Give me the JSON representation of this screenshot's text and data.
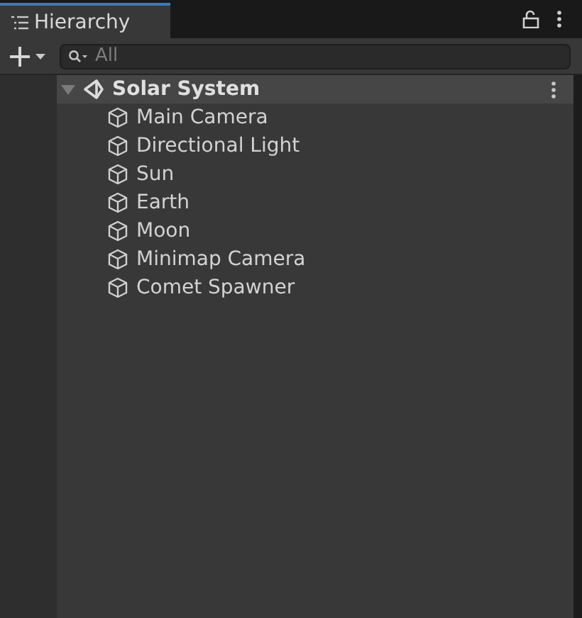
{
  "tab": {
    "title": "Hierarchy",
    "selected": true
  },
  "search": {
    "placeholder": "All"
  },
  "scene": {
    "name": "Solar System",
    "expanded": true,
    "children": [
      {
        "name": "Main Camera"
      },
      {
        "name": "Directional Light"
      },
      {
        "name": "Sun"
      },
      {
        "name": "Earth"
      },
      {
        "name": "Moon"
      },
      {
        "name": "Minimap Camera"
      },
      {
        "name": "Comet Spawner"
      }
    ]
  }
}
